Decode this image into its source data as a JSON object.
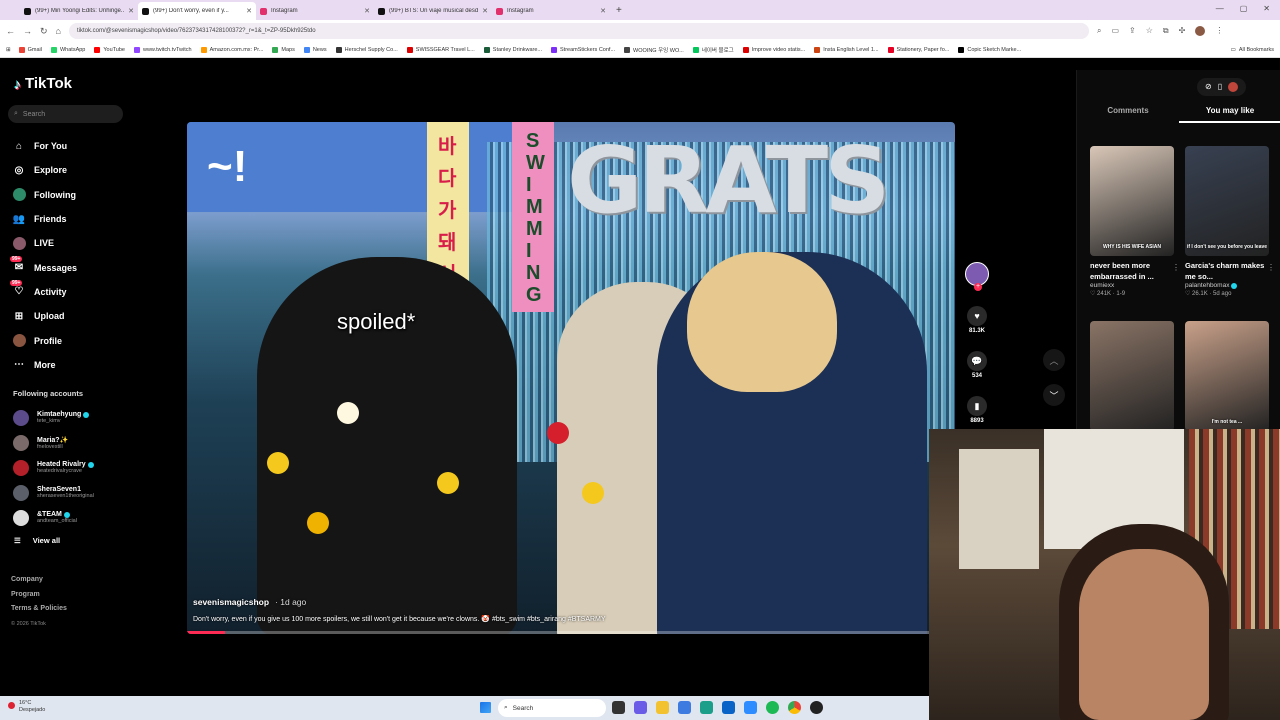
{
  "browser": {
    "tabs": [
      {
        "label": "(99+) Min Yoongi Edits: Unhinge...",
        "color": "#111"
      },
      {
        "label": "(99+) Don't worry, even if y...",
        "color": "#111",
        "active": true
      },
      {
        "label": "Instagram",
        "color": "#e1306c"
      },
      {
        "label": "(99+) BTS: Un viaje musical desd...",
        "color": "#111"
      },
      {
        "label": "Instagram",
        "color": "#e1306c"
      }
    ],
    "url": "tiktok.com/@sevenismagicshop/video/7623734317428100372?_r=1&_t=ZP-95Dkh925tdo",
    "bookmarks": [
      {
        "label": "Gmail",
        "color": "#ea4335"
      },
      {
        "label": "WhatsApp",
        "color": "#25d366"
      },
      {
        "label": "YouTube",
        "color": "#ff0000"
      },
      {
        "label": "www.twitch.tvTwitch",
        "color": "#9146ff"
      },
      {
        "label": "Amazon.com.mx: Pr...",
        "color": "#ff9900"
      },
      {
        "label": "Maps",
        "color": "#34a853"
      },
      {
        "label": "News",
        "color": "#4285f4"
      },
      {
        "label": "Herschel Supply Co...",
        "color": "#333"
      },
      {
        "label": "SWISSGEAR Travel L...",
        "color": "#d00"
      },
      {
        "label": "Stanley Drinkware...",
        "color": "#1a5c3a"
      },
      {
        "label": "StreamStickers Conf...",
        "color": "#7b2ff7"
      },
      {
        "label": "WOOING 우잉 WO...",
        "color": "#444"
      },
      {
        "label": "네이버 블로그",
        "color": "#03c75a"
      },
      {
        "label": "Improve video statis...",
        "color": "#d00"
      },
      {
        "label": "Insta English Level 1...",
        "color": "#c41"
      },
      {
        "label": "Stationery, Paper fo...",
        "color": "#e60023"
      },
      {
        "label": "Copic Sketch Marke...",
        "color": "#000"
      }
    ],
    "all_bookmarks": "All Bookmarks"
  },
  "tiktok": {
    "brand": "TikTok",
    "search_placeholder": "Search",
    "nav": [
      {
        "label": "For You",
        "icon": "home-icon",
        "glyph": "⌂"
      },
      {
        "label": "Explore",
        "icon": "compass-icon",
        "glyph": "◎"
      },
      {
        "label": "Following",
        "icon": "following-avatar-icon",
        "glyph": ""
      },
      {
        "label": "Friends",
        "icon": "friends-icon",
        "glyph": "👥"
      },
      {
        "label": "LIVE",
        "icon": "live-avatar-icon",
        "glyph": ""
      },
      {
        "label": "Messages",
        "icon": "messages-icon",
        "glyph": "✉",
        "badge": "99+"
      },
      {
        "label": "Activity",
        "icon": "activity-icon",
        "glyph": "♡",
        "badge": "99+"
      },
      {
        "label": "Upload",
        "icon": "upload-icon",
        "glyph": "⊞"
      },
      {
        "label": "Profile",
        "icon": "profile-avatar-icon",
        "glyph": ""
      },
      {
        "label": "More",
        "icon": "more-icon",
        "glyph": "⋯"
      }
    ],
    "following_title": "Following accounts",
    "accounts": [
      {
        "name": "Kimtaehyung",
        "handle": "tete_kimv",
        "verified": true,
        "color": "#5b4b8a"
      },
      {
        "name": "Maria?✨",
        "handle": "fnelovestill",
        "verified": false,
        "color": "#7a6a6a"
      },
      {
        "name": "Heated Rivalry",
        "handle": "heatedrivalrycrave",
        "verified": true,
        "color": "#b3202a"
      },
      {
        "name": "SheraSeven1",
        "handle": "sheraseven1theoriginal",
        "verified": false,
        "color": "#5a5f6a"
      },
      {
        "name": "&TEAM",
        "handle": "andteam_official",
        "verified": true,
        "color": "#ddd"
      }
    ],
    "view_all": "View all",
    "footer": [
      "Company",
      "Program",
      "Terms & Policies"
    ],
    "copyright": "© 2026 TikTok"
  },
  "video": {
    "overlay_text": "spoiled*",
    "author": "sevenismagicshop",
    "age": "· 1d ago",
    "caption": "Don't worry, even if you give us 100 more spoilers, we still won't get it because we're clowns. 🤡 #bts_swim #bts_arirang #BTSARMY",
    "progress_percent": 5,
    "scene_text": {
      "banner": "~!",
      "korean": "바다가돼서",
      "swimming": "SWIMMING",
      "grats": "GRATS"
    }
  },
  "actions": {
    "likes": "81.3K",
    "comments": "534",
    "saves": "8893"
  },
  "panel": {
    "tabs": [
      "Comments",
      "You may like"
    ],
    "selected_tab": "You may like",
    "cards": [
      {
        "caption": "WHY IS HIS WIFE ASIAN",
        "title": "never been more embarrassed in ...",
        "user": "eumiexx",
        "verified": false,
        "meta": "♡ 241K · 1-9",
        "color": "#d9c7b8"
      },
      {
        "caption": "if I don't see you before you leave",
        "title": "Garcia's charm makes me so...",
        "user": "palantehbomax",
        "verified": true,
        "meta": "♡ 26.1K · 5d ago",
        "color": "#384152"
      },
      {
        "caption": "",
        "title": "",
        "user": "",
        "verified": false,
        "meta": "",
        "color": "#8a7466"
      },
      {
        "caption": "I'm not tea ...",
        "title": "",
        "user": "",
        "verified": false,
        "meta": "",
        "color": "#c9a18a"
      }
    ]
  },
  "taskbar": {
    "temp": "16°C",
    "weather": "Despejado",
    "search": "Search"
  }
}
